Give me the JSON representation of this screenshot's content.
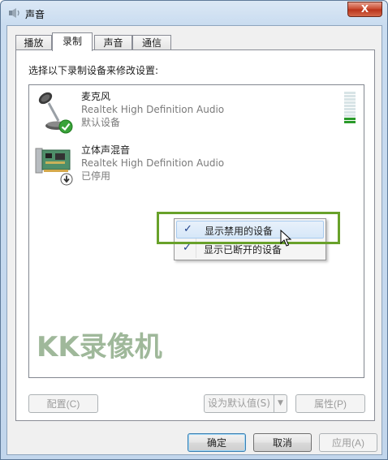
{
  "window": {
    "title": "声音",
    "close_label": "X"
  },
  "tabs": [
    {
      "label": "播放",
      "active": false
    },
    {
      "label": "录制",
      "active": true
    },
    {
      "label": "声音",
      "active": false
    },
    {
      "label": "通信",
      "active": false
    }
  ],
  "instruction": "选择以下录制设备来修改设置:",
  "devices": [
    {
      "name": "麦克风",
      "driver": "Realtek High Definition Audio",
      "status": "默认设备",
      "icon": "microphone-icon",
      "badge": "default-check-icon"
    },
    {
      "name": "立体声混音",
      "driver": "Realtek High Definition Audio",
      "status": "已停用",
      "icon": "sound-card-icon",
      "badge": "disabled-arrow-icon"
    }
  ],
  "level_meter": {
    "segments": 10,
    "lit": 2
  },
  "context_menu": {
    "items": [
      {
        "label": "显示禁用的设备",
        "checked": true,
        "hovered": true
      },
      {
        "label": "显示已断开的设备",
        "checked": true,
        "hovered": false
      }
    ],
    "check_glyph": "✓"
  },
  "watermark": "KK录像机",
  "panel_buttons": {
    "configure": "配置(C)",
    "set_default": "设为默认值(S)",
    "properties": "属性(P)"
  },
  "dialog_buttons": {
    "ok": "确定",
    "cancel": "取消",
    "apply": "应用(A)"
  },
  "colors": {
    "highlight_box": "#68a12a",
    "check": "#1d3f8a",
    "meter_on": "#2a9a2a"
  }
}
